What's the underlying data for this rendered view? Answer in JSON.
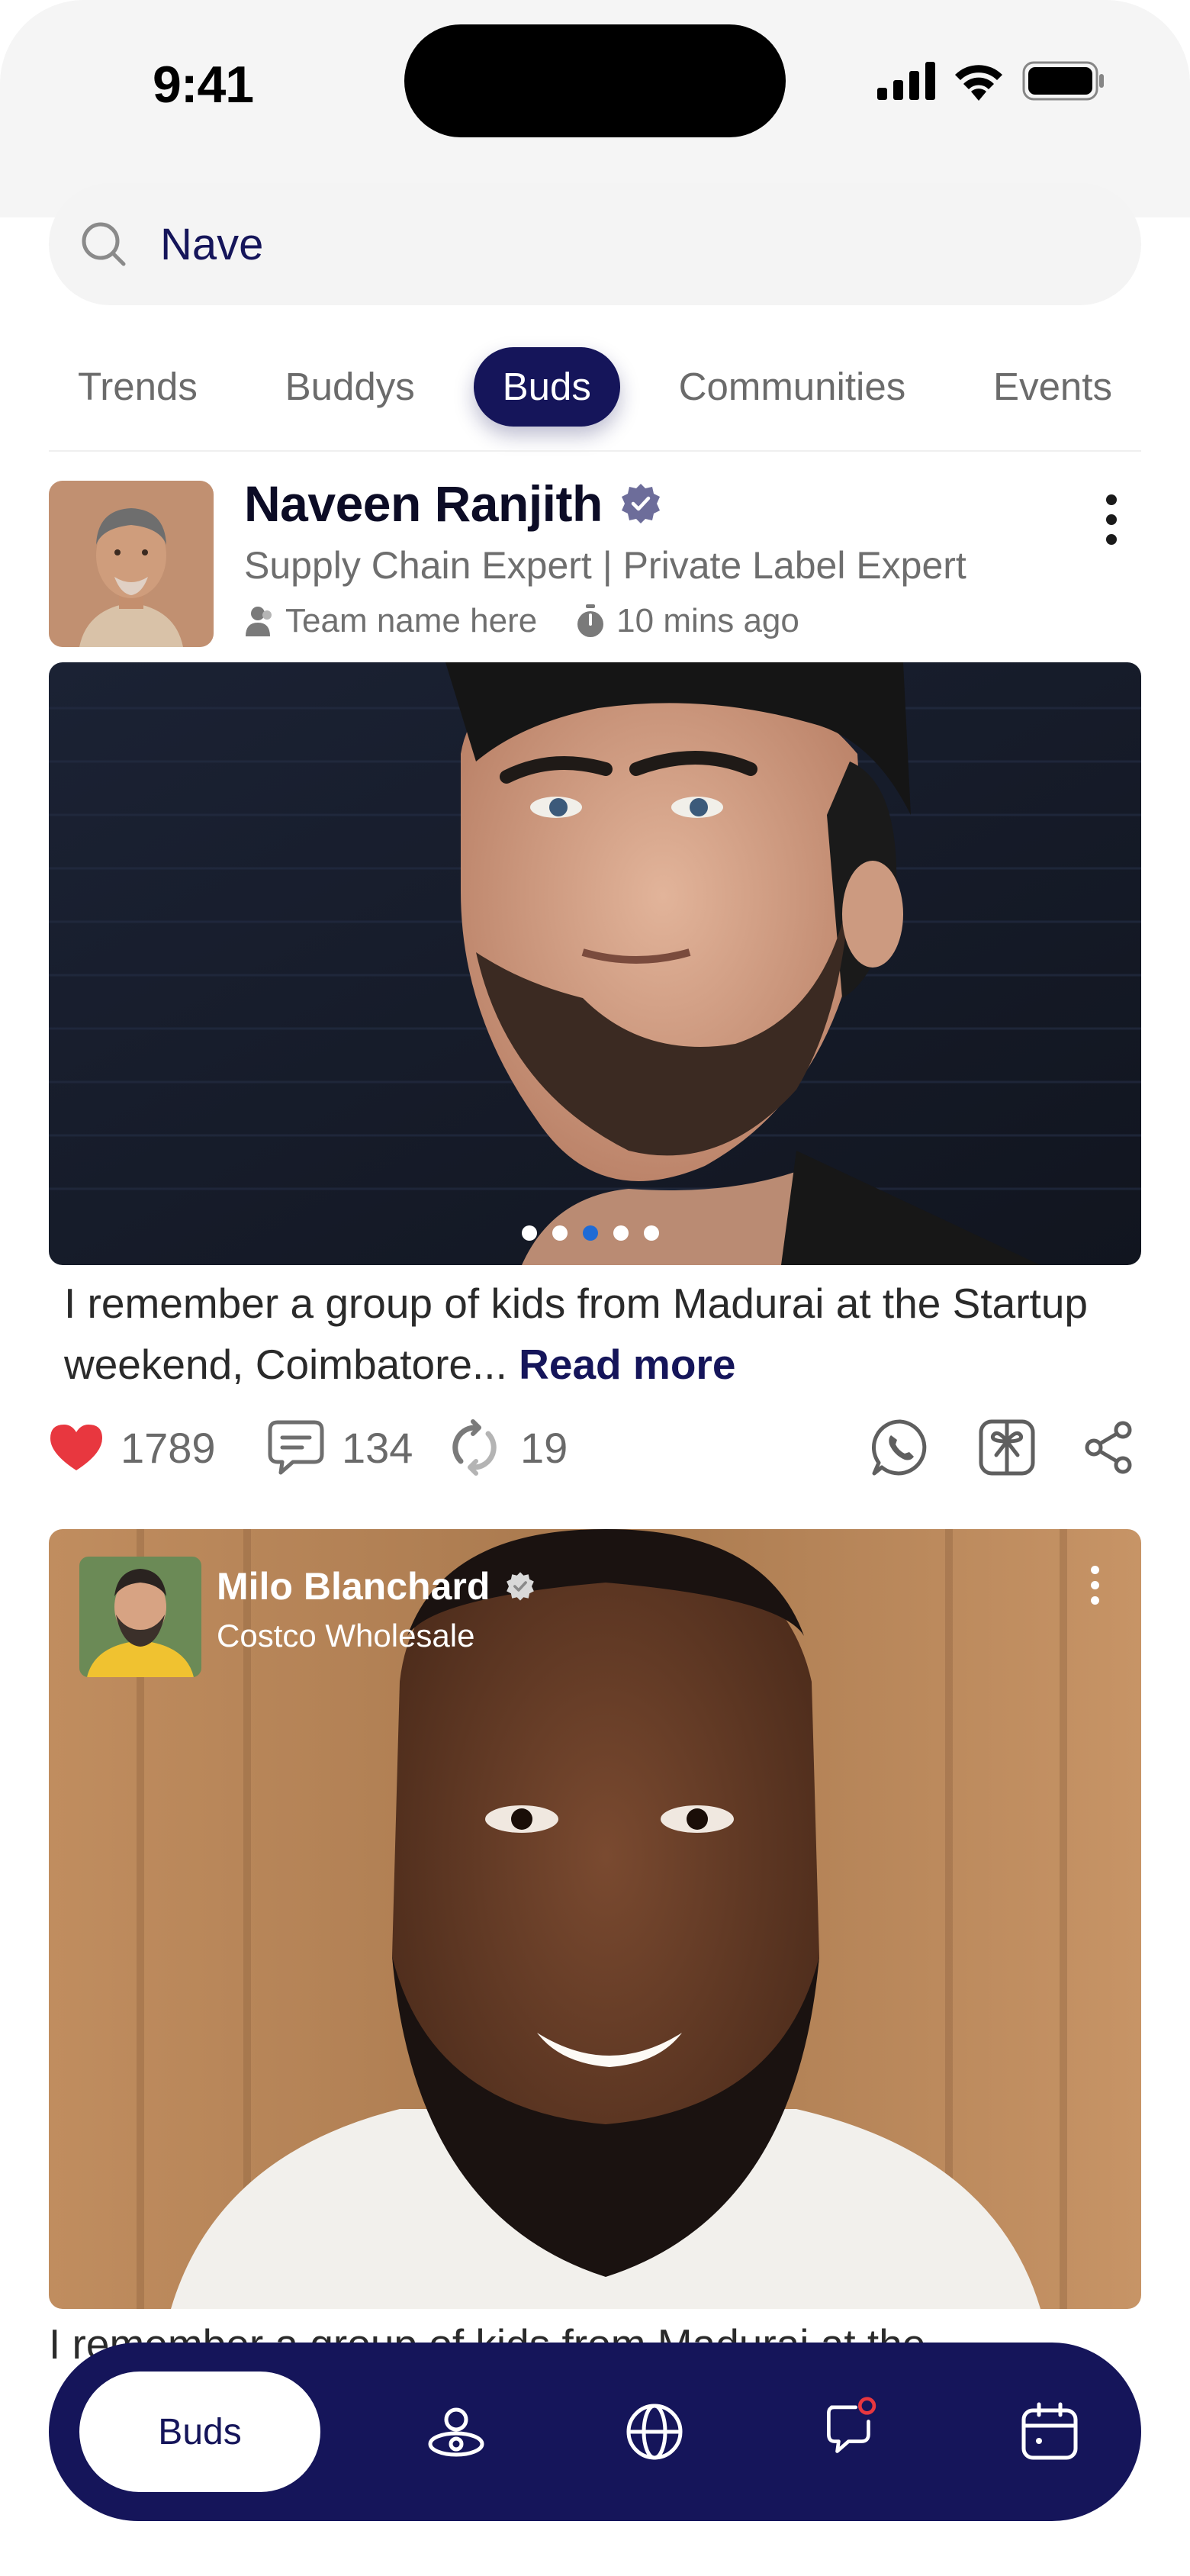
{
  "status_bar": {
    "time": "9:41"
  },
  "search": {
    "value": "Nave",
    "icon": "search-icon"
  },
  "tabs": [
    {
      "label": "Trends",
      "active": false
    },
    {
      "label": "Buddys",
      "active": false
    },
    {
      "label": "Buds",
      "active": true
    },
    {
      "label": "Communities",
      "active": false
    },
    {
      "label": "Events",
      "active": false
    }
  ],
  "post1": {
    "author": "Naveen Ranjith",
    "verified": true,
    "title": "Supply Chain Expert | Private Label Expert",
    "team": "Team name here",
    "time": "10 mins ago",
    "text": "I remember a group of kids from Madurai at the Startup weekend, Coimbatore...",
    "read_more": "Read more",
    "carousel": {
      "count": 5,
      "active_index": 2
    },
    "likes": "1789",
    "comments": "134",
    "reposts": "19"
  },
  "post2": {
    "author": "Milo Blanchard",
    "verified": true,
    "company": "Costco Wholesale",
    "text": "I remember a group of kids from Madurai at the"
  },
  "bottom_nav": {
    "active_label": "Buds",
    "items": [
      "buds",
      "buddys-icon",
      "globe-icon",
      "chat-icon",
      "calendar-icon"
    ]
  },
  "colors": {
    "brand": "#15155a",
    "like": "#e8373f",
    "carousel_active": "#1e6bd6",
    "notification": "#e8373f"
  }
}
